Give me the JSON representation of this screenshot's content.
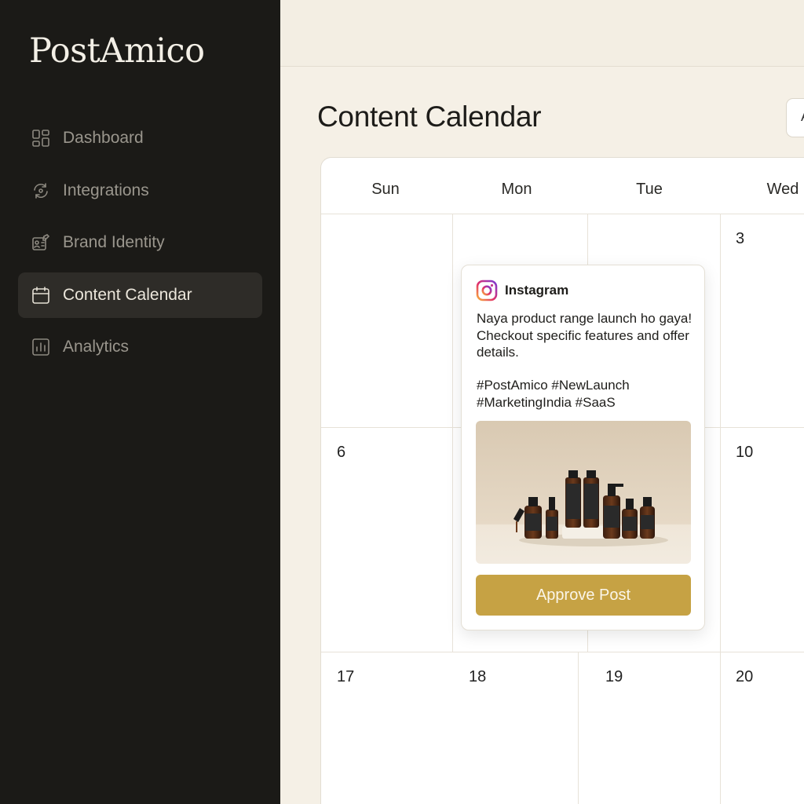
{
  "app": {
    "logo_text": "PostAmico"
  },
  "sidebar": {
    "items": [
      {
        "label": "Dashboard",
        "icon": "dashboard-grid-icon",
        "active": false
      },
      {
        "label": "Integrations",
        "icon": "sync-arrows-icon",
        "active": false
      },
      {
        "label": "Brand Identity",
        "icon": "id-card-edit-icon",
        "active": false
      },
      {
        "label": "Content Calendar",
        "icon": "calendar-icon",
        "active": true
      },
      {
        "label": "Analytics",
        "icon": "bar-chart-icon",
        "active": false
      }
    ]
  },
  "header": {
    "title": "Content Calendar",
    "action_label": "A"
  },
  "calendar": {
    "weekdays": [
      "Sun",
      "Mon",
      "Tue",
      "Wed"
    ],
    "dates": {
      "row1_wed": "3",
      "row2_sun": "6",
      "row2_wed": "10",
      "row3_sun": "17",
      "row3_mon": "18",
      "row3_tue": "19",
      "row3_wed": "20"
    }
  },
  "post": {
    "platform": "Instagram",
    "platform_icon": "instagram-icon",
    "caption": "Naya product range launch ho gaya! Checkout specific features and offer details.",
    "hashtags": "#PostAmico #NewLaunch #MarketingIndia #SaaS",
    "image_icon": "product-bottles-image",
    "approve_label": "Approve Post"
  },
  "colors": {
    "sidebar_bg": "#1b1a17",
    "page_bg": "#f5f0e6",
    "accent_gold": "#c6a244",
    "active_item_bg": "#2e2c28"
  }
}
